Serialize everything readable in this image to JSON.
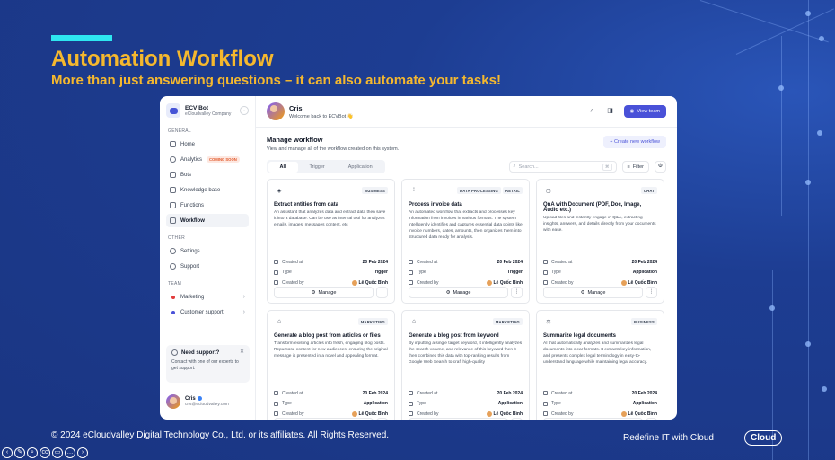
{
  "slide": {
    "title": "Automation Workflow",
    "subtitle": "More than just answering questions – it can also automate your tasks!",
    "footer_left": "© 2024 eCloudvalley Digital Technology Co., Ltd. or its affiliates. All Rights Reserved.",
    "footer_right": "Redefine IT with Cloud",
    "logo_text": "Cloud"
  },
  "sidebar": {
    "brand_name": "ECV Bot",
    "brand_company": "eCloudvalley Company",
    "general_label": "GENERAL",
    "general_items": [
      {
        "label": "Home",
        "icon": "home-icon"
      },
      {
        "label": "Analytics",
        "icon": "analytics-icon",
        "badge": "COMING SOON"
      },
      {
        "label": "Bots",
        "icon": "bot-icon"
      },
      {
        "label": "Knowledge base",
        "icon": "book-icon"
      },
      {
        "label": "Functions",
        "icon": "function-icon"
      },
      {
        "label": "Workflow",
        "icon": "workflow-icon",
        "active": true
      }
    ],
    "other_label": "OTHER",
    "other_items": [
      {
        "label": "Settings",
        "icon": "gear-icon"
      },
      {
        "label": "Support",
        "icon": "headset-icon"
      }
    ],
    "team_label": "TEAM",
    "team_items": [
      {
        "label": "Marketing",
        "color": "#e23c3c"
      },
      {
        "label": "Customer support",
        "color": "#4951d8"
      }
    ],
    "support": {
      "title": "Need support?",
      "text": "Contact with one of our experts to get support."
    },
    "user": {
      "name": "Cris",
      "email": "cris@ecloudvalley.com"
    }
  },
  "topbar": {
    "name": "Cris",
    "welcome": "Welcome back to ECVBot 👋",
    "view_team": "View team"
  },
  "page": {
    "title": "Manage workflow",
    "description": "View and manage all of the workflow created on this system.",
    "create_label": "Create new workflow",
    "tabs": [
      "All",
      "Trigger",
      "Application"
    ],
    "search_placeholder": "Search...",
    "search_shortcut": "⌘",
    "filter_label": "Filter"
  },
  "meta_labels": {
    "created_at": "Created at",
    "type": "Type",
    "created_by": "Created by",
    "manage": "Manage"
  },
  "workflows": [
    {
      "icon": "layers-icon",
      "tags": [
        "BUSINESS"
      ],
      "title": "Extract entities from data",
      "desc": "An assistant that analyzes data and extract data then save it into a database. Can be use as internal tool for analyzes emails, images, messages content, etc",
      "created_at": "20 Feb 2024",
      "type": "Trigger",
      "created_by": "Lê Quốc Bình"
    },
    {
      "icon": "waveform-icon",
      "tags": [
        "DATA PROCESSING",
        "RETAIL"
      ],
      "title": "Process invoice data",
      "desc": "An automated workflow that extracts and processes key information from invoices in various formats. The system intelligently identifies and captures essential data points like invoice numbers, dates, amounts, then organizes them into structured data ready for analysis.",
      "created_at": "20 Feb 2024",
      "type": "Trigger",
      "created_by": "Lê Quốc Bình"
    },
    {
      "icon": "chat-icon",
      "tags": [
        "CHAT"
      ],
      "title": "QnA with Document (PDF, Doc, Image, Audio etc.)",
      "desc": "Upload files and instantly engage in Q&A, extracting insights, answers, and details directly from your documents with ease.",
      "created_at": "20 Feb 2024",
      "type": "Application",
      "created_by": "Lê Quốc Bình"
    },
    {
      "icon": "document-icon",
      "tags": [
        "MARKETING"
      ],
      "title": "Generate a blog post from articles or files",
      "desc": "Transform existing articles into fresh, engaging blog posts. Repurpose content for new audiences, ensuring the original message is presented in a novel and appealing format.",
      "created_at": "20 Feb 2024",
      "type": "Application",
      "created_by": "Lê Quốc Bình"
    },
    {
      "icon": "document-icon",
      "tags": [
        "MARKETING"
      ],
      "title": "Generate a blog post from keyword",
      "desc": "By inputting a single target keyword, it intelligently analyzes the search volume, and relevance of this keyword then it then combines this data with top-ranking results from Google Web Search to craft high-quality",
      "created_at": "20 Feb 2024",
      "type": "Application",
      "created_by": "Lê Quốc Bình"
    },
    {
      "icon": "legal-icon",
      "tags": [
        "BUSINESS"
      ],
      "title": "Summarize legal documents",
      "desc": "AI that automatically analyzes and summarizes legal documents into clear formats. It extracts key information, and presents complex legal terminology in easy-to-understand language while maintaining legal accuracy.",
      "created_at": "20 Feb 2024",
      "type": "Application",
      "created_by": "Lê Quốc Bình"
    }
  ]
}
